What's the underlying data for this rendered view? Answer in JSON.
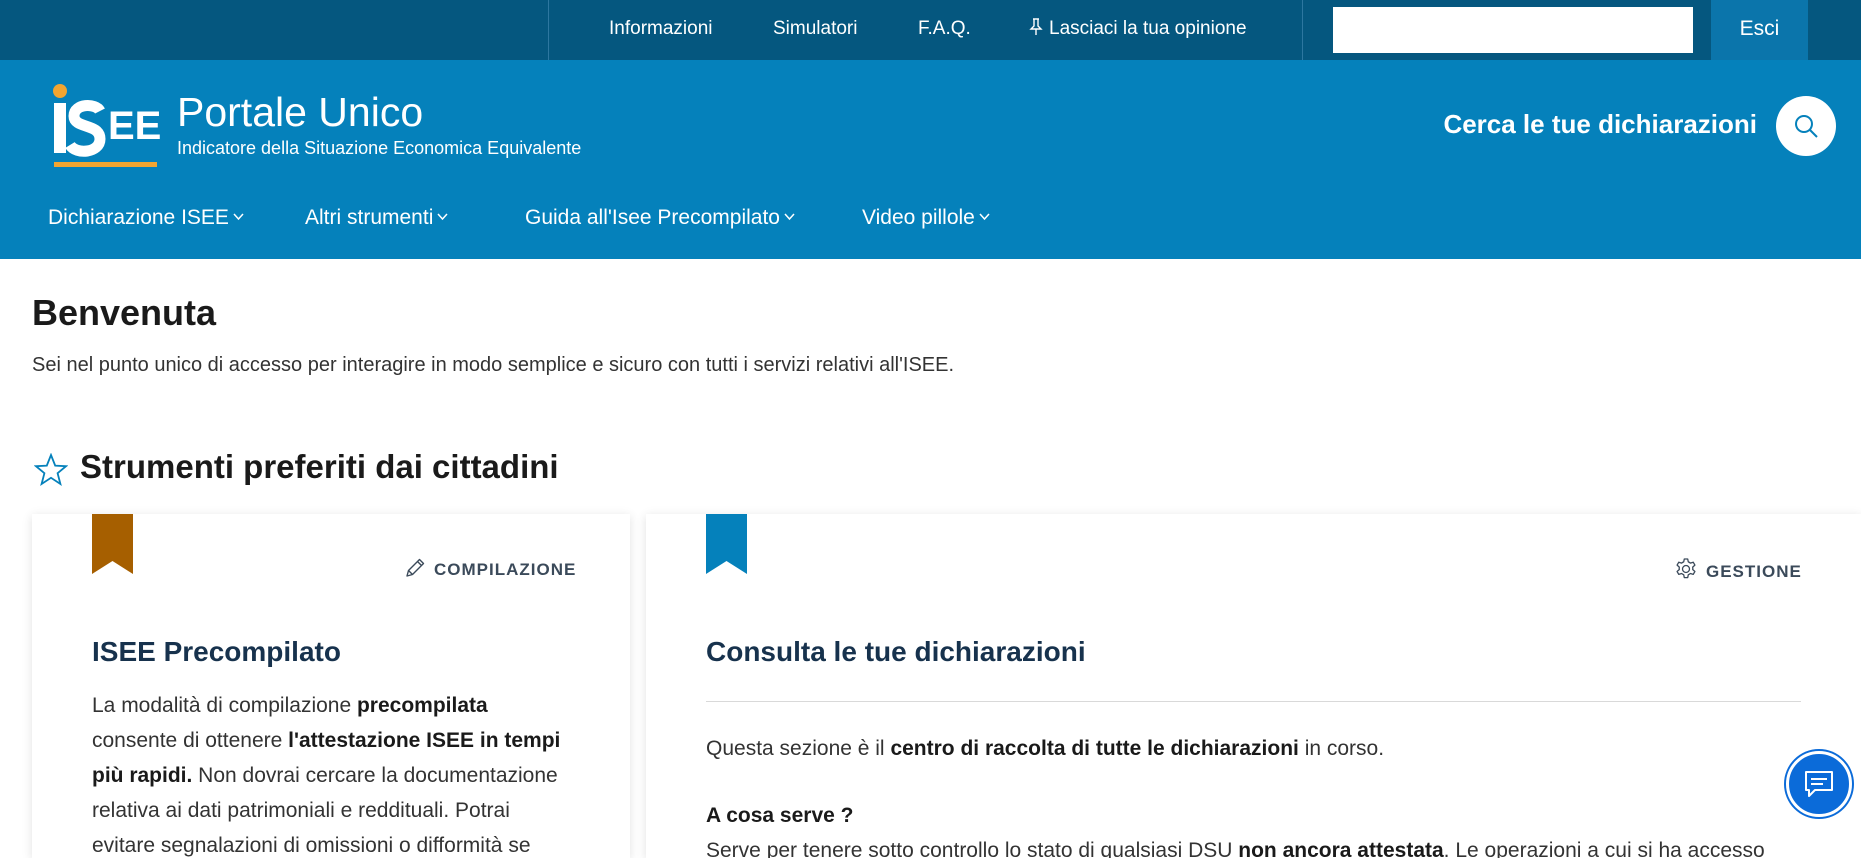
{
  "topbar": {
    "links": [
      "Informazioni",
      "Simulatori",
      "F.A.Q.",
      "Lasciaci la tua opinione"
    ],
    "search_value": "",
    "logout_label": "Esci"
  },
  "header": {
    "logo_text": "iSEE",
    "title": "Portale Unico",
    "subtitle": "Indicatore della Situazione Economica Equivalente",
    "search_label": "Cerca le tue dichiarazioni"
  },
  "nav": {
    "items": [
      "Dichiarazione ISEE",
      "Altri strumenti",
      "Guida all'Isee Precompilato",
      "Video pillole"
    ]
  },
  "main": {
    "welcome": "Benvenuta",
    "intro": "Sei nel punto unico di accesso per interagire in modo semplice e sicuro con tutti i servizi relativi all'ISEE.",
    "section_title": "Strumenti preferiti dai cittadini"
  },
  "cards": [
    {
      "tag": "COMPILAZIONE",
      "title": "ISEE Precompilato",
      "body": {
        "t1": "La modalità di compilazione ",
        "b1": "precompilata",
        "t2": " consente di ottenere ",
        "b2": "l'attestazione ISEE in tempi più rapidi.",
        "t3": " Non dovrai cercare la documentazione relativa ai dati patrimoniali e reddituali. Potrai evitare segnalazioni di omissioni o difformità se"
      },
      "bookmark_color": "#a65f00"
    },
    {
      "tag": "GESTIONE",
      "title": "Consulta le tue dichiarazioni",
      "p1": {
        "t1": "Questa sezione è il ",
        "b1": "centro di raccolta di tutte le dichiarazioni",
        "t2": " in corso."
      },
      "question": "A cosa serve ?",
      "p2": {
        "t1": "Serve per tenere sotto controllo lo stato di qualsiasi DSU ",
        "b1": "non ancora attestata",
        "t2": ". Le operazioni a cui si ha accesso"
      },
      "bookmark_color": "#0581bb"
    }
  ],
  "colors": {
    "topbar": "#05577f",
    "header": "#0581bb",
    "chat_button": "#0b6bd9"
  },
  "icons": [
    "pin-icon",
    "search-icon",
    "chevron-down-icon",
    "star-icon",
    "pencil-icon",
    "gear-icon",
    "chat-icon"
  ]
}
